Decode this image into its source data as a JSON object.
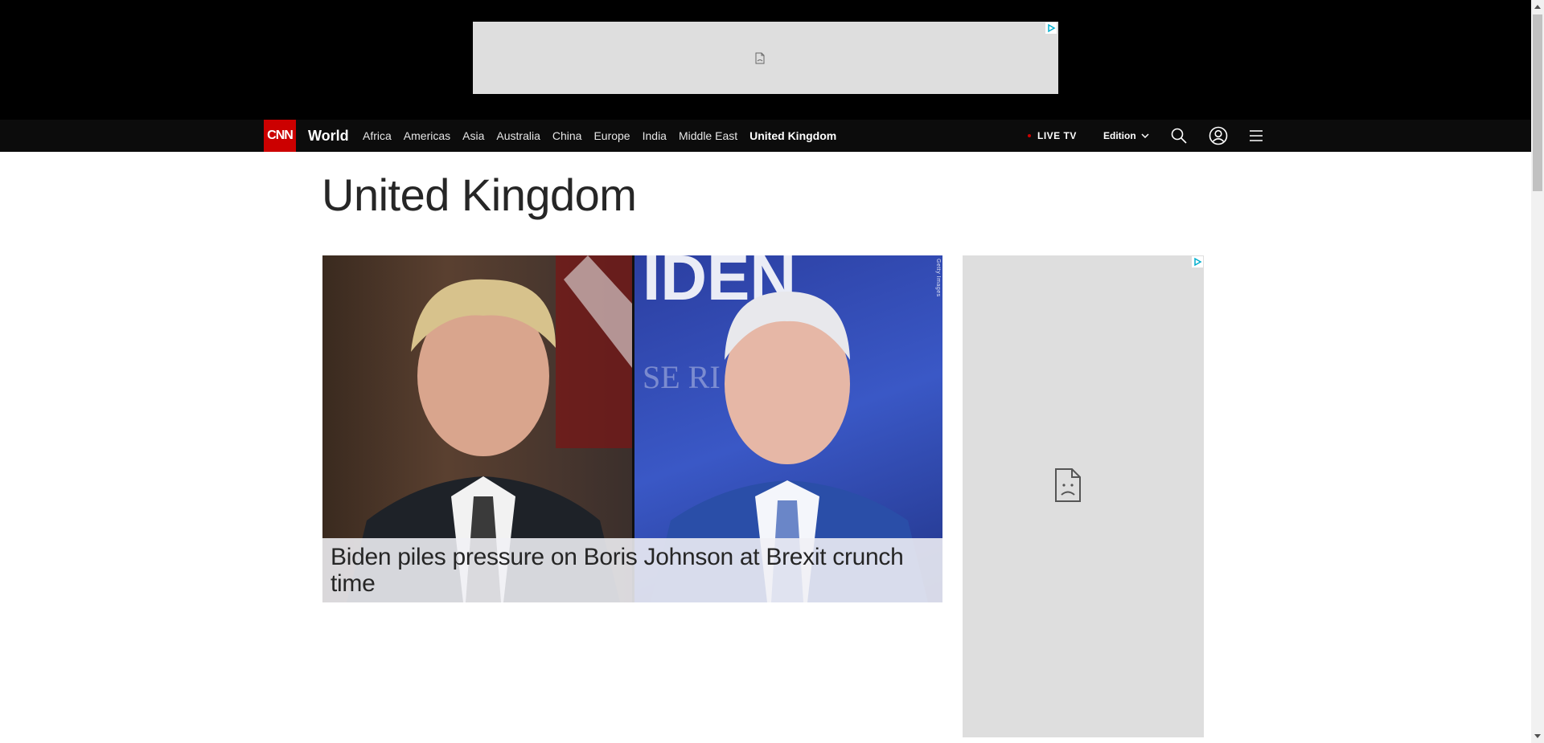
{
  "ads": {
    "top_ad": {
      "adchoices_icon": "adchoices-icon",
      "placeholder_icon": "broken-image-icon"
    },
    "side_ad": {
      "adchoices_icon": "adchoices-icon",
      "placeholder_icon": "broken-image-icon"
    }
  },
  "nav": {
    "logo": "CNN",
    "section": "World",
    "links": [
      "Africa",
      "Americas",
      "Asia",
      "Australia",
      "China",
      "Europe",
      "India",
      "Middle East",
      "United Kingdom"
    ],
    "active_link": "United Kingdom",
    "live_tv": "LIVE TV",
    "edition": "Edition",
    "icons": [
      "search-icon",
      "account-icon",
      "menu-icon"
    ]
  },
  "page": {
    "title": "United Kingdom"
  },
  "hero": {
    "headline": "Biden piles pressure on Boris Johnson at Brexit crunch time",
    "image_credit": "Getty Images"
  },
  "colors": {
    "brand_red": "#cc0000",
    "nav_bg": "#0c0c0c",
    "ad_bg": "#dedede"
  }
}
